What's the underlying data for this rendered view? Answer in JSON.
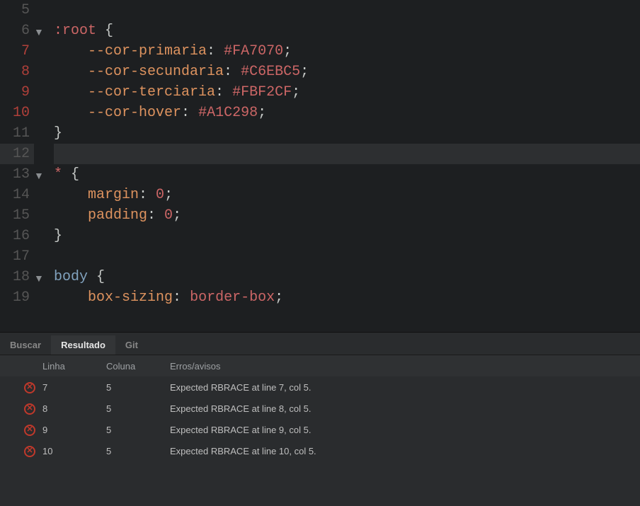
{
  "editor": {
    "lines": [
      {
        "num": "5",
        "err": false,
        "fold": "",
        "tokens": []
      },
      {
        "num": "6",
        "err": false,
        "fold": "▼",
        "tokens": [
          {
            "t": ":root ",
            "c": "tok-selector"
          },
          {
            "t": "{",
            "c": "tok-punct"
          }
        ]
      },
      {
        "num": "7",
        "err": true,
        "fold": "",
        "tokens": [
          {
            "t": "    ",
            "c": ""
          },
          {
            "t": "--cor-primaria",
            "c": "tok-prop"
          },
          {
            "t": ": ",
            "c": "tok-punct"
          },
          {
            "t": "#FA7070",
            "c": "tok-value"
          },
          {
            "t": ";",
            "c": "tok-punct"
          }
        ]
      },
      {
        "num": "8",
        "err": true,
        "fold": "",
        "tokens": [
          {
            "t": "    ",
            "c": ""
          },
          {
            "t": "--cor-secundaria",
            "c": "tok-prop"
          },
          {
            "t": ": ",
            "c": "tok-punct"
          },
          {
            "t": "#C6EBC5",
            "c": "tok-value"
          },
          {
            "t": ";",
            "c": "tok-punct"
          }
        ]
      },
      {
        "num": "9",
        "err": true,
        "fold": "",
        "tokens": [
          {
            "t": "    ",
            "c": ""
          },
          {
            "t": "--cor-terciaria",
            "c": "tok-prop"
          },
          {
            "t": ": ",
            "c": "tok-punct"
          },
          {
            "t": "#FBF2CF",
            "c": "tok-value"
          },
          {
            "t": ";",
            "c": "tok-punct"
          }
        ]
      },
      {
        "num": "10",
        "err": true,
        "fold": "",
        "tokens": [
          {
            "t": "    ",
            "c": ""
          },
          {
            "t": "--cor-hover",
            "c": "tok-prop"
          },
          {
            "t": ": ",
            "c": "tok-punct"
          },
          {
            "t": "#A1C298",
            "c": "tok-value"
          },
          {
            "t": ";",
            "c": "tok-punct"
          }
        ]
      },
      {
        "num": "11",
        "err": false,
        "fold": "",
        "tokens": [
          {
            "t": "}",
            "c": "tok-punct"
          }
        ]
      },
      {
        "num": "12",
        "err": false,
        "fold": "",
        "active": true,
        "tokens": []
      },
      {
        "num": "13",
        "err": false,
        "fold": "▼",
        "tokens": [
          {
            "t": "* ",
            "c": "tok-selector"
          },
          {
            "t": "{",
            "c": "tok-punct"
          }
        ]
      },
      {
        "num": "14",
        "err": false,
        "fold": "",
        "tokens": [
          {
            "t": "    ",
            "c": ""
          },
          {
            "t": "margin",
            "c": "tok-prop"
          },
          {
            "t": ": ",
            "c": "tok-punct"
          },
          {
            "t": "0",
            "c": "tok-num"
          },
          {
            "t": ";",
            "c": "tok-punct"
          }
        ]
      },
      {
        "num": "15",
        "err": false,
        "fold": "",
        "tokens": [
          {
            "t": "    ",
            "c": ""
          },
          {
            "t": "padding",
            "c": "tok-prop"
          },
          {
            "t": ": ",
            "c": "tok-punct"
          },
          {
            "t": "0",
            "c": "tok-num"
          },
          {
            "t": ";",
            "c": "tok-punct"
          }
        ]
      },
      {
        "num": "16",
        "err": false,
        "fold": "",
        "tokens": [
          {
            "t": "}",
            "c": "tok-punct"
          }
        ]
      },
      {
        "num": "17",
        "err": false,
        "fold": "",
        "tokens": []
      },
      {
        "num": "18",
        "err": false,
        "fold": "▼",
        "tokens": [
          {
            "t": "body ",
            "c": "tok-tag"
          },
          {
            "t": "{",
            "c": "tok-punct"
          }
        ]
      },
      {
        "num": "19",
        "err": false,
        "fold": "",
        "tokens": [
          {
            "t": "    ",
            "c": ""
          },
          {
            "t": "box-sizing",
            "c": "tok-prop"
          },
          {
            "t": ": ",
            "c": "tok-punct"
          },
          {
            "t": "border-box",
            "c": "tok-value"
          },
          {
            "t": ";",
            "c": "tok-punct"
          }
        ]
      }
    ]
  },
  "panel": {
    "tabs": [
      {
        "label": "Buscar",
        "active": false
      },
      {
        "label": "Resultado",
        "active": true
      },
      {
        "label": "Git",
        "active": false
      }
    ],
    "headers": {
      "line": "Linha",
      "col": "Coluna",
      "msg": "Erros/avisos"
    },
    "rows": [
      {
        "line": "7",
        "col": "5",
        "msg": "Expected RBRACE at line 7, col 5."
      },
      {
        "line": "8",
        "col": "5",
        "msg": "Expected RBRACE at line 8, col 5."
      },
      {
        "line": "9",
        "col": "5",
        "msg": "Expected RBRACE at line 9, col 5."
      },
      {
        "line": "10",
        "col": "5",
        "msg": "Expected RBRACE at line 10, col 5."
      }
    ],
    "error_glyph": "✕"
  }
}
